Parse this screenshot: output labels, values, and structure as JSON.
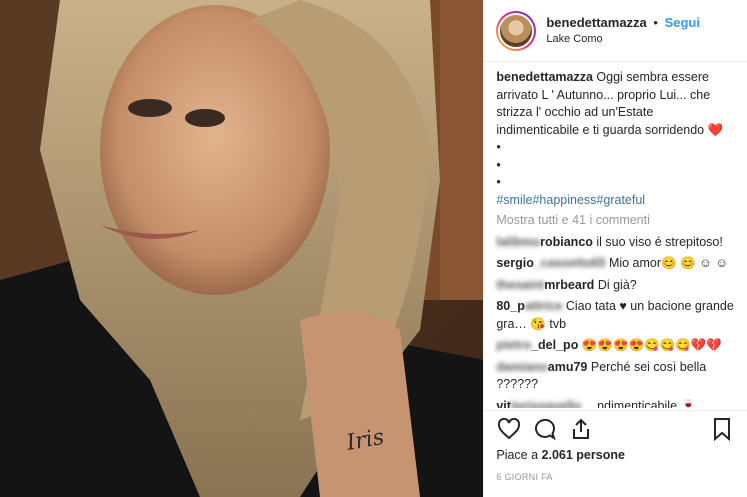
{
  "header": {
    "username": "benedettamazza",
    "separator": "•",
    "follow_label": "Segui",
    "location": "Lake Como"
  },
  "caption": {
    "username": "benedettamazza",
    "text": "Oggi sembra essere arrivato L ' Autunno... proprio Lui... che strizza l' occhio ad un'Estate indimenticabile e ti guarda sorridendo",
    "heart": "❤️",
    "bullets": [
      "•",
      "•",
      "•"
    ],
    "hashtags": "#smile#happiness#grateful"
  },
  "show_all_comments": "Mostra tutti e 41 i commenti",
  "comments": [
    {
      "user_blurred": "lalibmo",
      "user": "robianco",
      "text": "il suo viso é strepitoso!"
    },
    {
      "user": "sergio",
      "user_blurred": "_cassetto65",
      "text": "Mio amor😊 😊 ☺ ☺"
    },
    {
      "user_blurred": "thesaint",
      "user": "mrbeard",
      "text": "Di già?"
    },
    {
      "user": "80_p",
      "user_blurred": "attrice",
      "text": "Ciao tata ♥ un bacione grande gra… 😘 tvb"
    },
    {
      "user_blurred": "pietro",
      "user": "_del_po",
      "text": "😍😍😍😍😋😋😋💔💔"
    },
    {
      "user_blurred": "damiano",
      "user": "amu79",
      "text": "Perché sei così bella ??????"
    },
    {
      "user": "vit",
      "user_blurred": "toriosavello",
      "text": "…ndimenticabile 🍷"
    }
  ],
  "actions": {
    "like": "heart-outline-icon",
    "comment": "comment-icon",
    "share": "share-icon",
    "save": "bookmark-icon"
  },
  "likes_text_prefix": "Piace a ",
  "likes_count": "2.061 persone",
  "post_age": "6 GIORNI FA",
  "colors": {
    "link": "#3897f0",
    "hashtag": "#3f729b",
    "heart": "#e0245e"
  }
}
